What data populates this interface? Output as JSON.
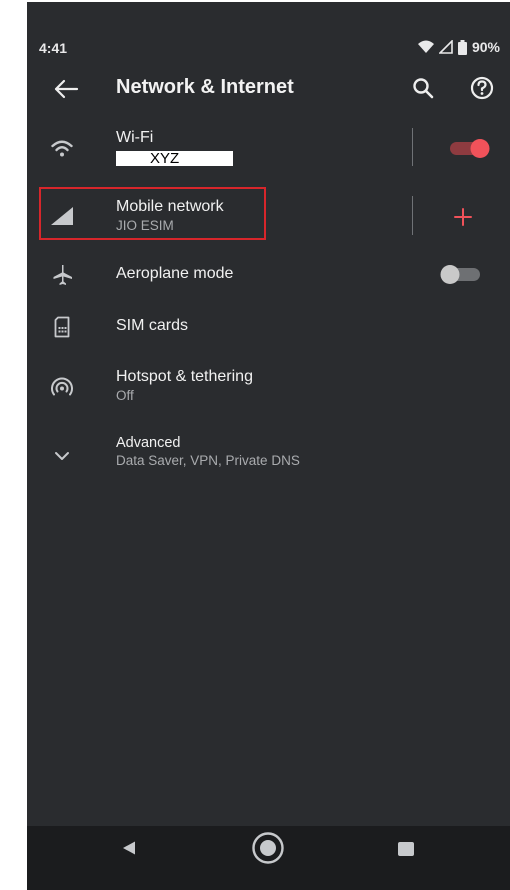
{
  "status_bar": {
    "time": "4:41",
    "battery": "90%",
    "icons": [
      "wifi-icon",
      "signal-icon",
      "battery-icon"
    ]
  },
  "app_bar": {
    "title": "Network & Internet",
    "back_icon": "arrow-back-icon",
    "search_icon": "search-icon",
    "help_icon": "help-circle-icon"
  },
  "settings": {
    "wifi": {
      "label": "Wi-Fi",
      "value": "XYZ",
      "toggle_on": true,
      "icon": "wifi-icon"
    },
    "mobile": {
      "label": "Mobile network",
      "value": "JIO ESIM",
      "icon": "signal-icon",
      "action_icon": "plus-icon"
    },
    "aeroplane": {
      "label": "Aeroplane mode",
      "toggle_on": false,
      "icon": "airplane-icon"
    },
    "sim": {
      "label": "SIM cards",
      "icon": "sim-card-icon"
    },
    "hotspot": {
      "label": "Hotspot & tethering",
      "value": "Off",
      "icon": "hotspot-icon"
    },
    "advanced": {
      "label": "Advanced",
      "value": "Data Saver, VPN, Private DNS",
      "icon": "chevron-down-icon"
    }
  },
  "nav_bar": {
    "icons": [
      "nav-back-icon",
      "nav-home-icon",
      "nav-recents-icon"
    ]
  },
  "colors": {
    "background": "#2a2c2f",
    "accent": "#f0525a",
    "highlight_border": "#d7262b",
    "toggle_off": "#c9c9c9"
  }
}
